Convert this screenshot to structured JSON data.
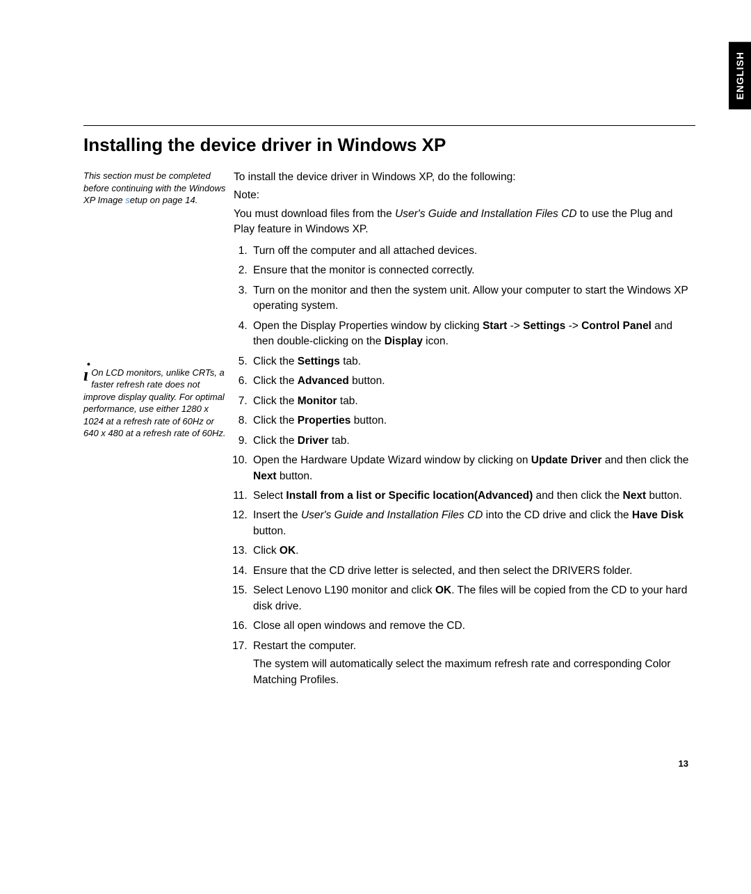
{
  "lang_tab": "ENGLISH",
  "title": "Installing the device driver in Windows XP",
  "side_note": {
    "pre": "This section must be completed before continuing with the Windows XP Image ",
    "s_letter": "s",
    "post": "etup on page 14."
  },
  "tip_note": "On LCD monitors, unlike CRTs, a faster refresh rate does not improve display quality. For optimal performance, use either 1280 x 1024 at a refresh rate of 60Hz or 640 x 480 at a refresh rate of 60Hz.",
  "intro": {
    "line1": "To install the device driver in Windows XP, do the following:",
    "line2": "Note:",
    "line3_pre": "You must download files from the ",
    "line3_em": "User's Guide and Installation Files CD",
    "line3_post": " to use the Plug and Play feature in Windows XP."
  },
  "steps": {
    "s1": "Turn off the computer and all attached devices.",
    "s2": "Ensure that the monitor is connected correctly.",
    "s3": "Turn on the monitor and then the system unit. Allow your computer to start the Windows XP operating system.",
    "s4_a": "Open the Display Properties window by clicking ",
    "s4_b1": "Start",
    "s4_ar1": " -> ",
    "s4_b2": "Settings",
    "s4_ar2": " -> ",
    "s4_b3": "Control Panel",
    "s4_mid": " and then double-clicking on the ",
    "s4_b4": "Display",
    "s4_end": " icon.",
    "s5_a": "Click the ",
    "s5_b": "Settings",
    "s5_c": " tab.",
    "s6_a": "Click the ",
    "s6_b": "Advanced",
    "s6_c": " button.",
    "s7_a": "Click the ",
    "s7_b": "Monitor",
    "s7_c": " tab.",
    "s8_a": "Click the ",
    "s8_b": "Properties",
    "s8_c": " button.",
    "s9_a": "Click the ",
    "s9_b": "Driver",
    "s9_c": " tab.",
    "s10_a": "Open the Hardware Update Wizard window by clicking on ",
    "s10_b1": "Update Driver",
    "s10_mid": " and then click the ",
    "s10_b2": "Next",
    "s10_end": " button.",
    "s11_a": "Select ",
    "s11_b": "Install from a list or Specific location(Advanced)",
    "s11_mid": " and then click the ",
    "s11_b2": "Next",
    "s11_end": " button.",
    "s12_a": "Insert the ",
    "s12_em": "User's Guide and Installation Files CD",
    "s12_mid": " into the CD drive and click the ",
    "s12_b": "Have Disk",
    "s12_end": " button.",
    "s13_a": "Click ",
    "s13_b": "OK",
    "s13_end": ".",
    "s14": "Ensure that the CD drive letter is selected, and then select the DRIVERS folder.",
    "s15_a": "Select Lenovo L190 monitor and click ",
    "s15_b": "OK",
    "s15_end": ". The files will be copied from the CD to your hard disk drive.",
    "s16": "Close all open windows and remove the CD.",
    "s17_a": "Restart the computer.",
    "s17_sub": "The system will automatically select the maximum refresh rate and corresponding Color Matching Profiles."
  },
  "page_number": "13"
}
